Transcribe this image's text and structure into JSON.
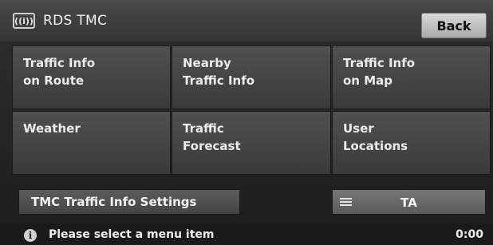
{
  "header": {
    "icon": "rds-radio-icon",
    "icon_glyph": "((i))",
    "title": "RDS TMC",
    "back_label": "Back"
  },
  "menu": {
    "items": [
      {
        "label": "Traffic Info\non Route"
      },
      {
        "label": "Nearby\nTraffic Info"
      },
      {
        "label": "Traffic Info\non Map"
      },
      {
        "label": "Weather"
      },
      {
        "label": "Traffic\nForecast"
      },
      {
        "label": "User\nLocations"
      }
    ]
  },
  "bottom": {
    "settings_label": "TMC Traffic Info Settings",
    "ta_label": "TA",
    "ta_icon": "list-lines-icon"
  },
  "status": {
    "icon": "info-icon",
    "message": "Please select a menu item",
    "time": "0:00"
  },
  "colors": {
    "background": "#2a2a2a",
    "tile": "#4a4a4a",
    "button_light": "#c4c4c4",
    "text": "#ececec"
  }
}
